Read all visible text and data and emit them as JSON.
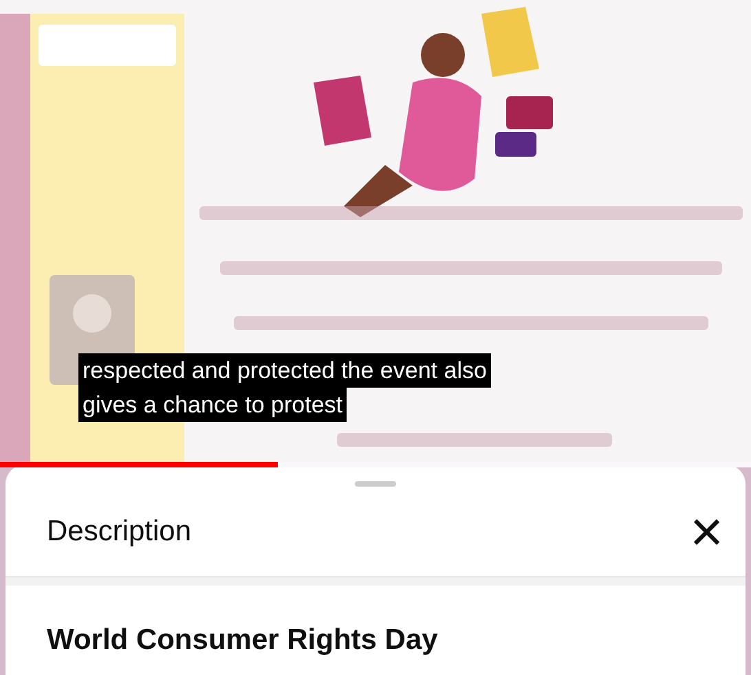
{
  "video": {
    "kind": "picture",
    "captions": [
      "respected and protected the event also",
      "gives a chance to protest"
    ],
    "progress": {
      "level": 0.37
    }
  },
  "sheet": {
    "title": "Description",
    "close": "×"
  },
  "description": {
    "heading": "World Consumer Rights Day"
  }
}
